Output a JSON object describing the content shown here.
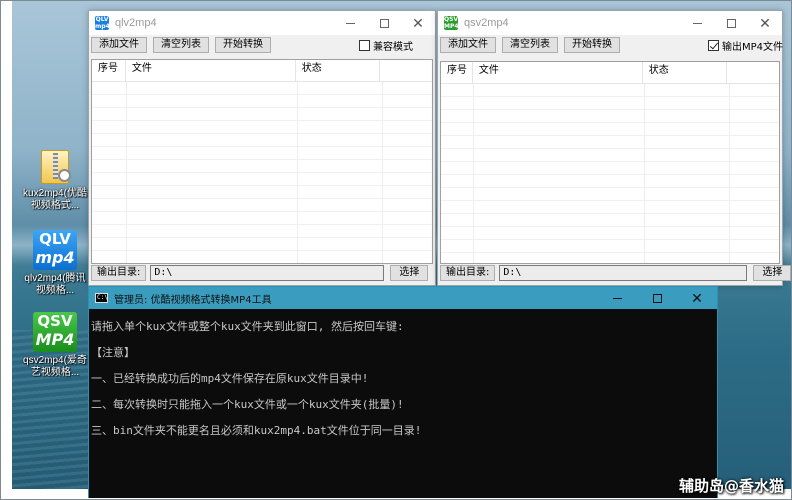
{
  "desktop": {
    "icons": [
      {
        "label": "kux2mp4(优酷视频格式...",
        "icon": "zip-folder-icon"
      },
      {
        "label": "qlv2mp4(腾讯视频格...",
        "logo_top": "QLV",
        "logo_bottom": "mp4",
        "icon": "qlv-logo-icon"
      },
      {
        "label": "qsv2mp4(爱奇艺视频格...",
        "logo_top": "QSV",
        "logo_bottom": "MP4",
        "icon": "qsv-logo-icon"
      }
    ]
  },
  "qlv_window": {
    "title": "qlv2mp4",
    "icon_text": "QLV mp4",
    "buttons": {
      "add": "添加文件",
      "clear": "清空列表",
      "start": "开始转换"
    },
    "checkbox": {
      "label": "兼容模式",
      "checked": false
    },
    "columns": [
      "序号",
      "文件",
      "状态"
    ],
    "output": {
      "label": "输出目录:",
      "value": "D:\\",
      "browse": "选择"
    }
  },
  "qsv_window": {
    "title": "qsv2mp4",
    "icon_text": "QSV MP4",
    "buttons": {
      "add": "添加文件",
      "clear": "清空列表",
      "start": "开始转换"
    },
    "checkbox": {
      "label": "输出MP4文件",
      "checked": true
    },
    "columns": [
      "序号",
      "文件",
      "状态"
    ],
    "output": {
      "label": "输出目录:",
      "value": "D:\\",
      "browse": "选择"
    }
  },
  "console": {
    "icon_text": "C:\\",
    "title": "管理员:  优酷视频格式转换MP4工具",
    "lines": [
      "请拖入单个kux文件或整个kux文件夹到此窗口, 然后按回车键:",
      "【注意】",
      "一、已经转换成功后的mp4文件保存在原kux文件目录中!",
      "二、每次转换时只能拖入一个kux文件或一个kux文件夹(批量)!",
      "三、bin文件夹不能更名且必须和kux2mp4.bat文件位于同一目录!"
    ]
  },
  "watermark": "辅助岛@香水猫"
}
